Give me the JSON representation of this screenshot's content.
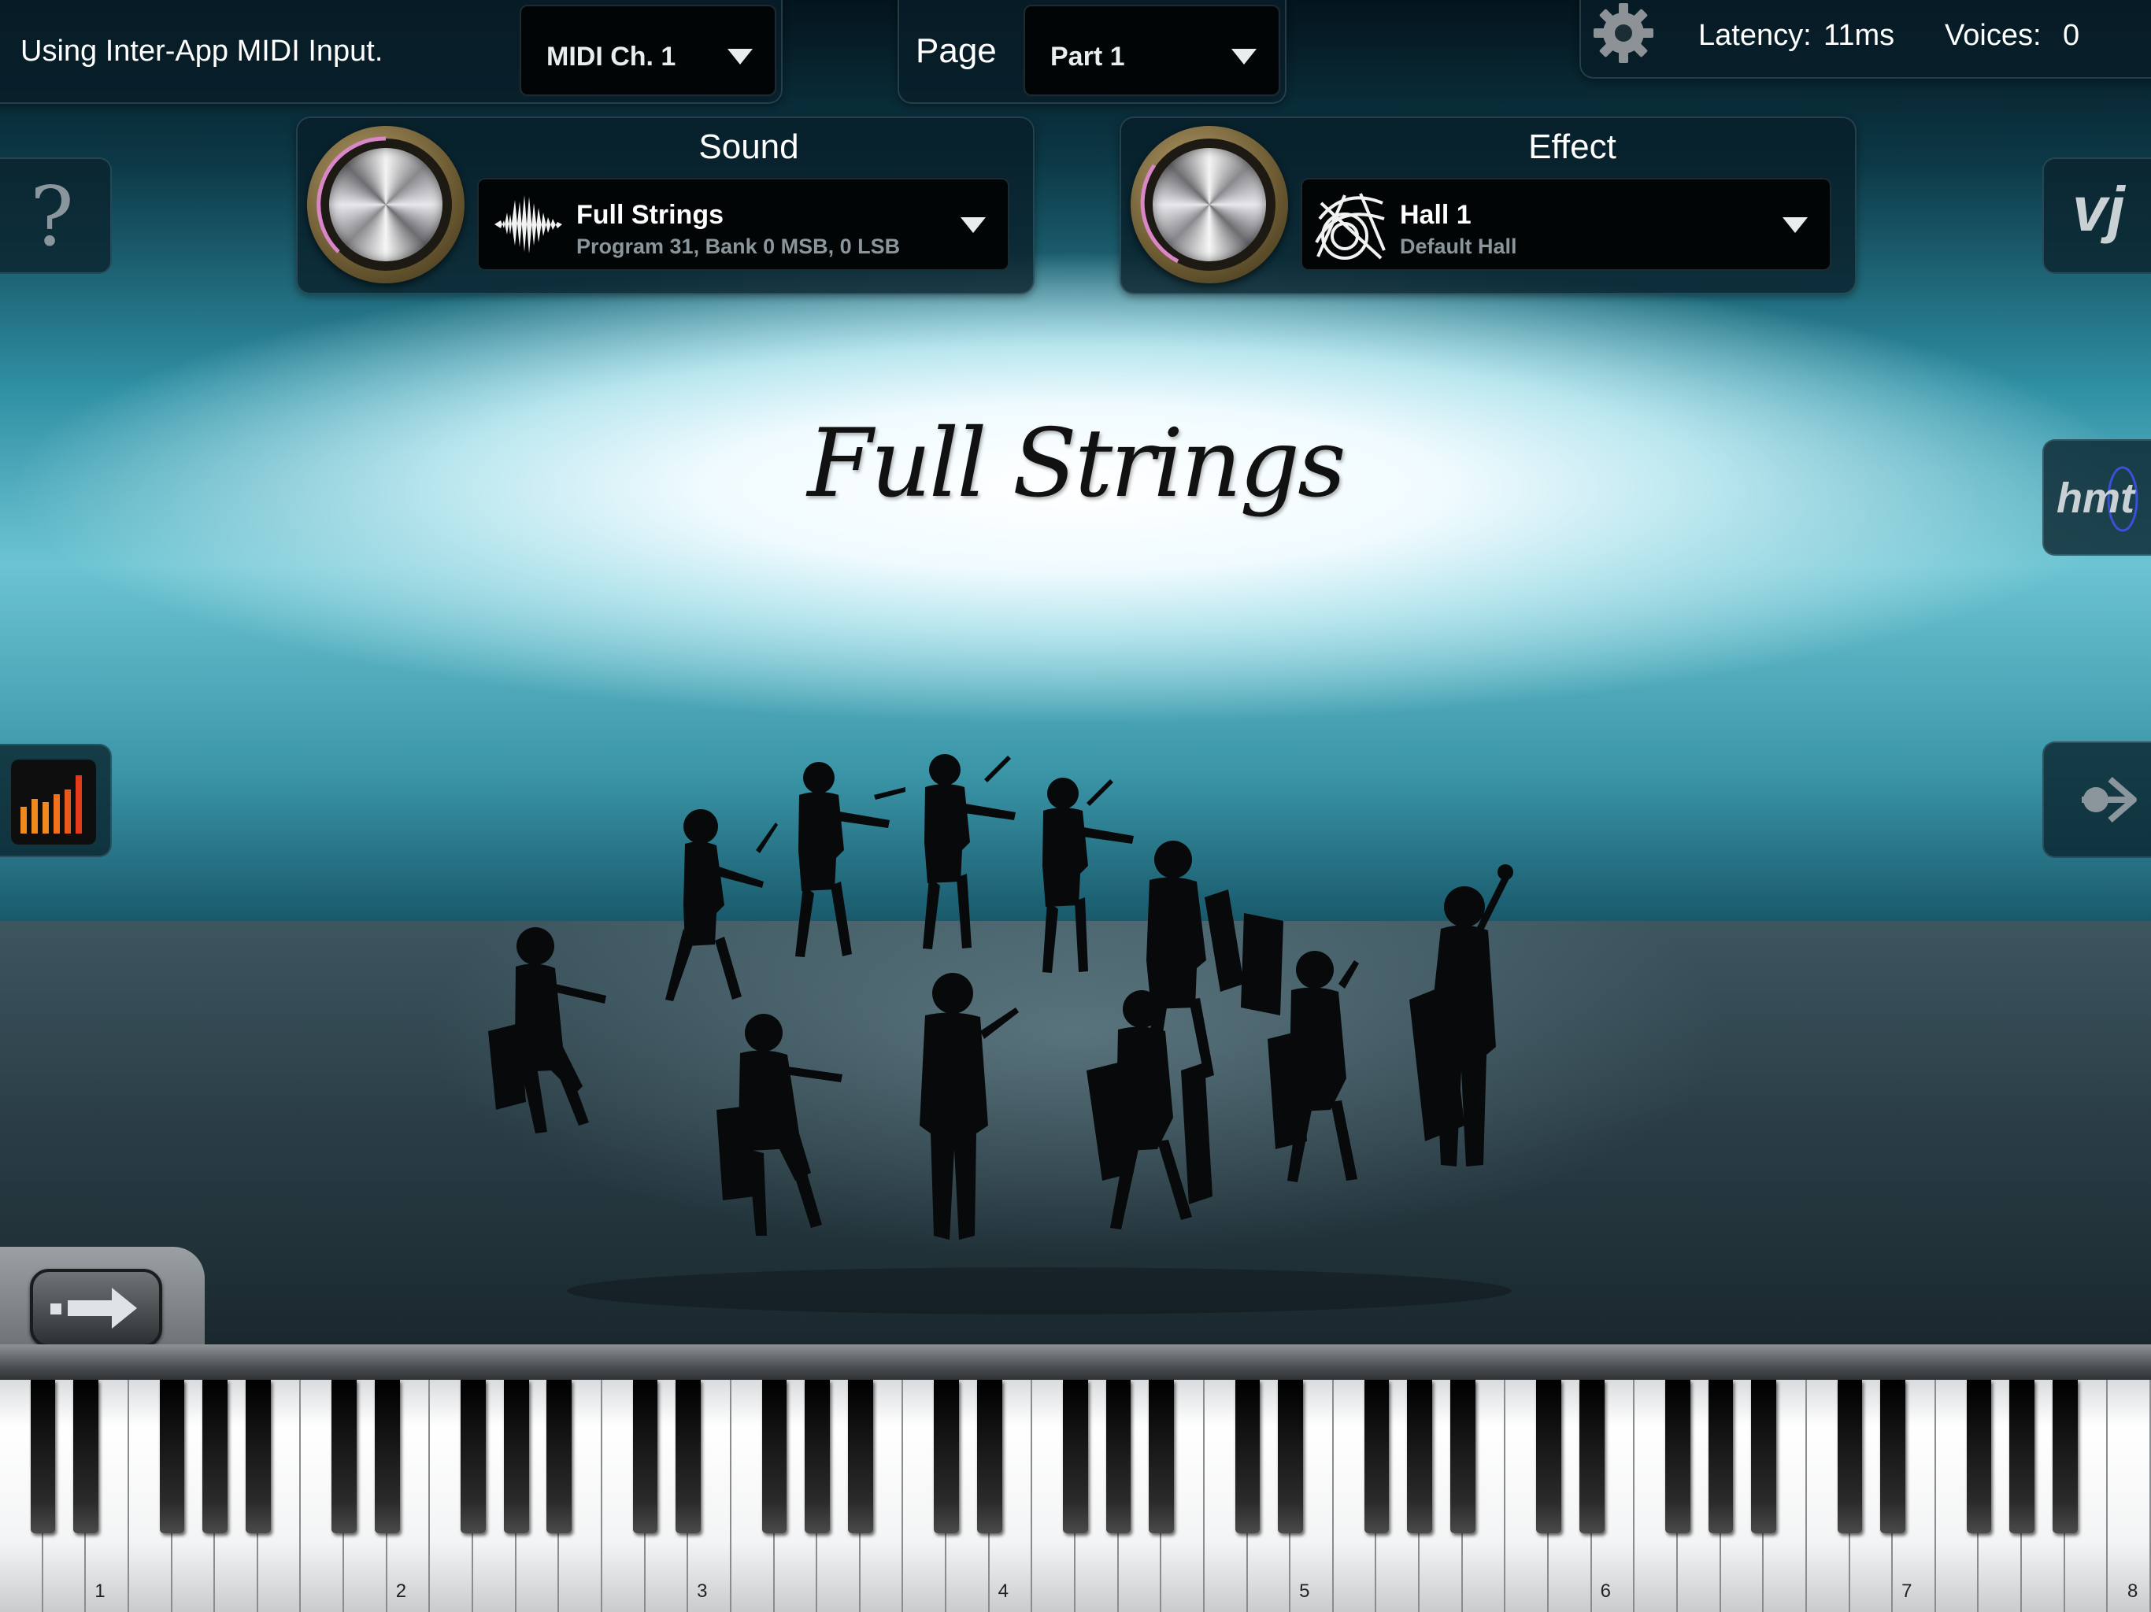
{
  "status_bar": {
    "midi_input": "Using Inter-App MIDI Input.",
    "midi_channel": "MIDI Ch. 1",
    "page_label": "Page",
    "page_value": "Part 1",
    "latency_label": "Latency:",
    "latency_value": "11ms",
    "voices_label": "Voices:",
    "voices_value": "0"
  },
  "sound": {
    "header": "Sound",
    "name": "Full Strings",
    "detail": "Program 31, Bank 0 MSB, 0 LSB"
  },
  "effect": {
    "header": "Effect",
    "name": "Hall 1",
    "detail": "Default Hall"
  },
  "stage": {
    "title": "Full Strings"
  },
  "side_buttons": {
    "help": "?",
    "vj": "vj",
    "hmt": "hmt"
  },
  "keyboard": {
    "octave_labels": [
      "1",
      "2",
      "3",
      "4",
      "5",
      "6",
      "7",
      "8"
    ]
  },
  "icons": {
    "settings": "gear-icon",
    "help": "question-icon",
    "meter": "level-meter-icon",
    "forward": "arrow-right-icon",
    "waveform": "waveform-icon",
    "hall": "hall-reverb-icon"
  },
  "colors": {
    "knob_arc": "#d987c8",
    "meter_orange": "#f08a1c",
    "meter_red": "#e23a1a"
  }
}
